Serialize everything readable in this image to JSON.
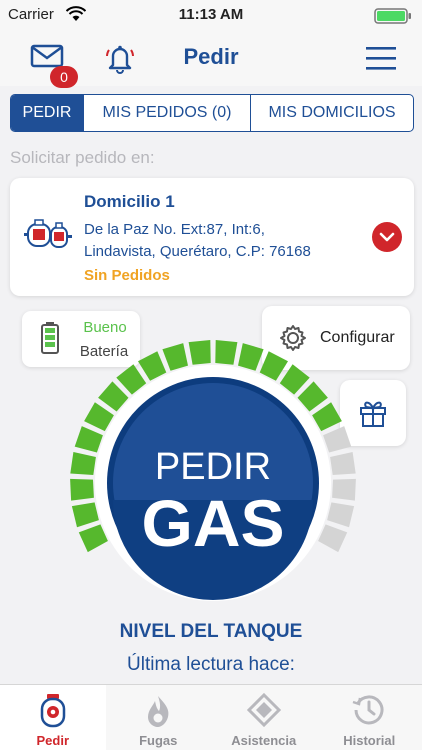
{
  "status_bar": {
    "carrier": "Carrier",
    "time": "11:13 AM"
  },
  "nav": {
    "title": "Pedir",
    "mail_badge": "0"
  },
  "segments": [
    {
      "label": "PEDIR",
      "active": true
    },
    {
      "label": "MIS PEDIDOS (0)",
      "active": false
    },
    {
      "label": "MIS DOMICILIOS",
      "active": false
    }
  ],
  "section_label": "Solicitar pedido en:",
  "address": {
    "name": "Domicilio 1",
    "line1": "De la Paz No. Ext:87, Int:6,",
    "line2": "Lindavista, Querétaro, C.P: 76168",
    "status": "Sin Pedidos"
  },
  "battery": {
    "value": "Bueno",
    "label": "Batería"
  },
  "config": {
    "label": "Configurar"
  },
  "gauge": {
    "line1": "PEDIR",
    "line2": "GAS",
    "level": 0.75
  },
  "tank": {
    "title": "NIVEL DEL TANQUE",
    "subtitle": "Última lectura hace:"
  },
  "tabs": [
    {
      "label": "Pedir",
      "icon": "gas-tank-icon",
      "active": true
    },
    {
      "label": "Fugas",
      "icon": "flame-icon",
      "active": false
    },
    {
      "label": "Asistencia",
      "icon": "diamond-icon",
      "active": false
    },
    {
      "label": "Historial",
      "icon": "history-icon",
      "active": false
    }
  ],
  "colors": {
    "brand_blue": "#1f4f96",
    "accent_red": "#d0262b",
    "gauge_green": "#56b82d",
    "gauge_gray": "#d4d4d4",
    "status_orange": "#f0a323"
  }
}
